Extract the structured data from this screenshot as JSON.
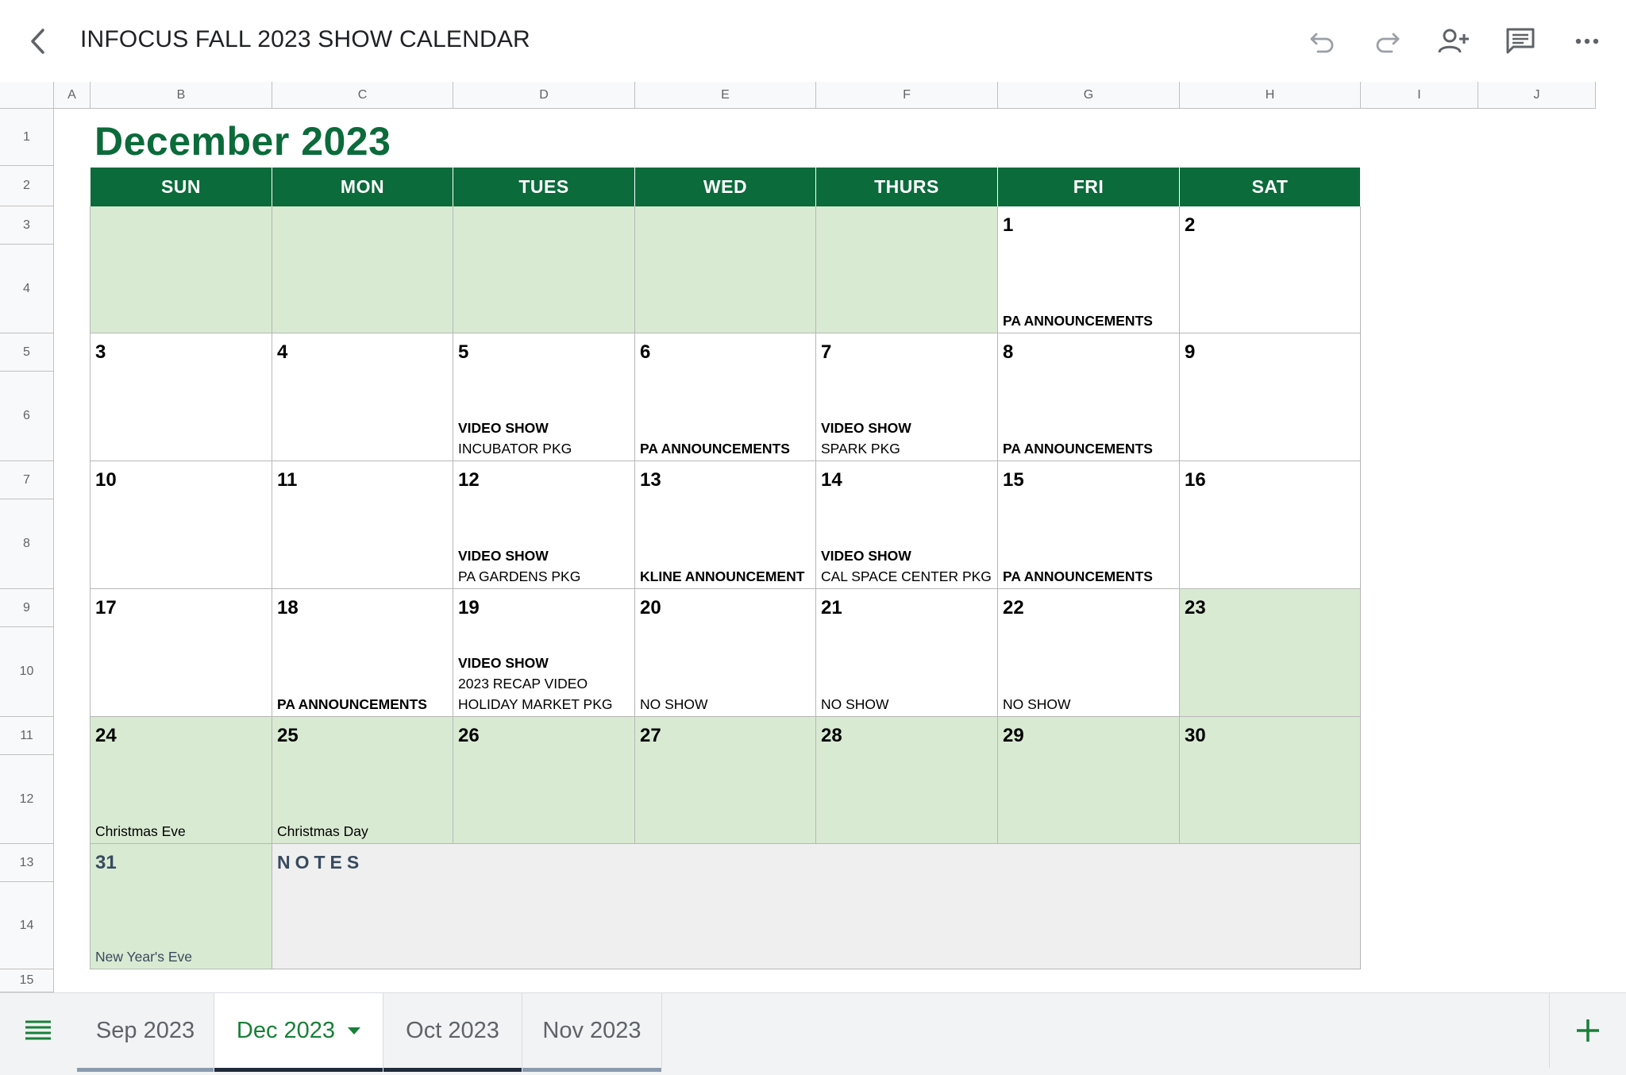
{
  "header": {
    "title": "INFOCUS FALL 2023 SHOW CALENDAR",
    "icons": [
      "back-icon",
      "undo-icon",
      "redo-icon",
      "add-person-icon",
      "comment-icon",
      "more-icon"
    ]
  },
  "grid": {
    "columns": [
      "A",
      "B",
      "C",
      "D",
      "E",
      "F",
      "G",
      "H",
      "I",
      "J"
    ],
    "rows": [
      "1",
      "2",
      "3",
      "4",
      "5",
      "6",
      "7",
      "8",
      "9",
      "10",
      "11",
      "12",
      "13",
      "14",
      "15"
    ]
  },
  "calendar": {
    "month_title": "December 2023",
    "weekdays": [
      "SUN",
      "MON",
      "TUES",
      "WED",
      "THURS",
      "FRI",
      "SAT"
    ],
    "accent_color": "#0b6b3a",
    "shade_color": "#d9ead3",
    "weeks": [
      [
        {
          "day": "",
          "shaded": true,
          "events": []
        },
        {
          "day": "",
          "shaded": true,
          "events": []
        },
        {
          "day": "",
          "shaded": true,
          "events": []
        },
        {
          "day": "",
          "shaded": true,
          "events": []
        },
        {
          "day": "",
          "shaded": true,
          "events": []
        },
        {
          "day": "1",
          "shaded": false,
          "events": [
            {
              "text": "PA ANNOUNCEMENTS",
              "bold": true
            }
          ]
        },
        {
          "day": "2",
          "shaded": false,
          "events": []
        }
      ],
      [
        {
          "day": "3",
          "shaded": false,
          "events": []
        },
        {
          "day": "4",
          "shaded": false,
          "events": []
        },
        {
          "day": "5",
          "shaded": false,
          "events": [
            {
              "text": "VIDEO SHOW",
              "bold": true
            },
            {
              "text": "INCUBATOR PKG",
              "bold": false
            }
          ]
        },
        {
          "day": "6",
          "shaded": false,
          "events": [
            {
              "text": "PA ANNOUNCEMENTS",
              "bold": true
            }
          ]
        },
        {
          "day": "7",
          "shaded": false,
          "events": [
            {
              "text": "VIDEO SHOW",
              "bold": true
            },
            {
              "text": "SPARK PKG",
              "bold": false
            }
          ]
        },
        {
          "day": "8",
          "shaded": false,
          "events": [
            {
              "text": "PA ANNOUNCEMENTS",
              "bold": true
            }
          ]
        },
        {
          "day": "9",
          "shaded": false,
          "events": []
        }
      ],
      [
        {
          "day": "10",
          "shaded": false,
          "events": []
        },
        {
          "day": "11",
          "shaded": false,
          "events": []
        },
        {
          "day": "12",
          "shaded": false,
          "events": [
            {
              "text": "VIDEO SHOW",
              "bold": true
            },
            {
              "text": "PA GARDENS PKG",
              "bold": false
            }
          ]
        },
        {
          "day": "13",
          "shaded": false,
          "events": [
            {
              "text": "KLINE ANNOUNCEMENT",
              "bold": true
            }
          ]
        },
        {
          "day": "14",
          "shaded": false,
          "events": [
            {
              "text": "VIDEO SHOW",
              "bold": true
            },
            {
              "text": "CAL SPACE CENTER PKG",
              "bold": false
            }
          ]
        },
        {
          "day": "15",
          "shaded": false,
          "events": [
            {
              "text": "PA ANNOUNCEMENTS",
              "bold": true
            }
          ]
        },
        {
          "day": "16",
          "shaded": false,
          "events": []
        }
      ],
      [
        {
          "day": "17",
          "shaded": false,
          "events": []
        },
        {
          "day": "18",
          "shaded": false,
          "events": [
            {
              "text": "PA ANNOUNCEMENTS",
              "bold": true
            }
          ]
        },
        {
          "day": "19",
          "shaded": false,
          "events": [
            {
              "text": "VIDEO SHOW",
              "bold": true
            },
            {
              "text": "2023 RECAP VIDEO",
              "bold": false
            },
            {
              "text": "HOLIDAY MARKET PKG",
              "bold": false
            }
          ]
        },
        {
          "day": "20",
          "shaded": false,
          "events": [
            {
              "text": "NO SHOW",
              "bold": false
            }
          ]
        },
        {
          "day": "21",
          "shaded": false,
          "events": [
            {
              "text": "NO SHOW",
              "bold": false
            }
          ]
        },
        {
          "day": "22",
          "shaded": false,
          "events": [
            {
              "text": "NO SHOW",
              "bold": false
            }
          ]
        },
        {
          "day": "23",
          "shaded": true,
          "events": []
        }
      ],
      [
        {
          "day": "24",
          "shaded": true,
          "events": [
            {
              "text": "Christmas Eve",
              "bold": false
            }
          ]
        },
        {
          "day": "25",
          "shaded": true,
          "events": [
            {
              "text": "Christmas Day",
              "bold": false
            }
          ]
        },
        {
          "day": "26",
          "shaded": true,
          "events": []
        },
        {
          "day": "27",
          "shaded": true,
          "events": []
        },
        {
          "day": "28",
          "shaded": true,
          "events": []
        },
        {
          "day": "29",
          "shaded": true,
          "events": []
        },
        {
          "day": "30",
          "shaded": true,
          "events": []
        }
      ]
    ],
    "last_day": {
      "day": "31",
      "events": [
        {
          "text": "New Year's Eve",
          "bold": false
        }
      ]
    },
    "notes_label": "NOTES"
  },
  "tabs": [
    {
      "label": "Sep 2023",
      "active": false,
      "bar_color": "#8a9bb0"
    },
    {
      "label": "Dec 2023",
      "active": true,
      "bar_color": "#1f2a3a"
    },
    {
      "label": "Oct 2023",
      "active": false,
      "bar_color": "#1f2a3a"
    },
    {
      "label": "Nov 2023",
      "active": false,
      "bar_color": "#8a9bb0"
    }
  ]
}
